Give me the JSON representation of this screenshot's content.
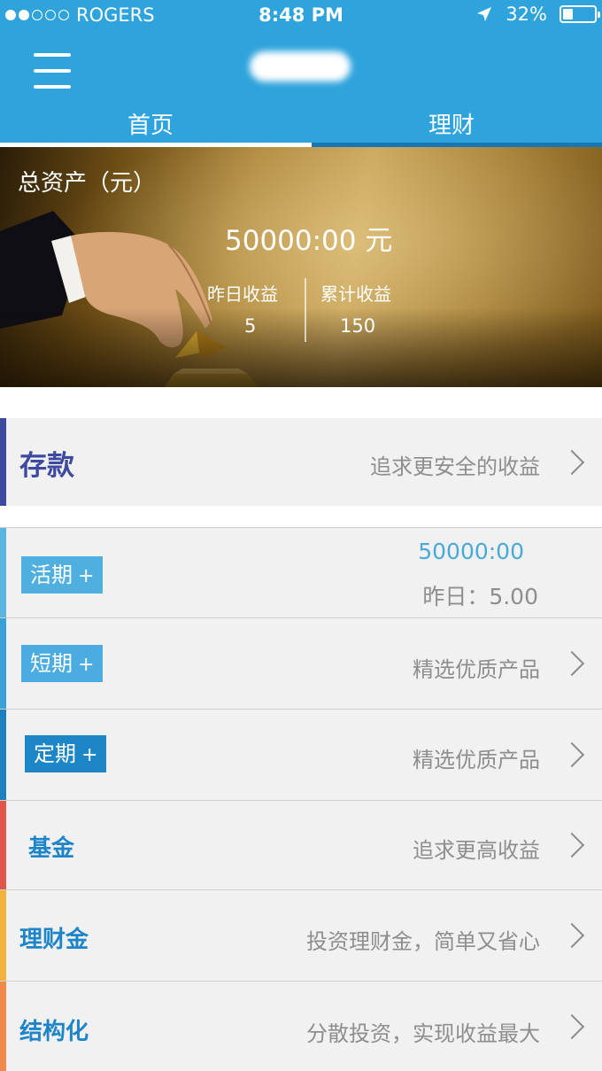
{
  "status_bar": {
    "carrier": "ROGERS",
    "time": "8:48 PM",
    "battery": "32%",
    "battery_level": 0.32
  },
  "header": {
    "tabs": [
      {
        "label": "首页",
        "active": true
      },
      {
        "label": "理财",
        "active": false
      }
    ]
  },
  "banner": {
    "label": "总资产（元）",
    "amount": "50000:00 元",
    "yesterday_label": "昨日收益",
    "yesterday_value": "5",
    "total_label": "累计收益",
    "total_value": "150"
  },
  "list": {
    "deposit": {
      "title": "存款",
      "desc": "追求更安全的收益"
    },
    "current": {
      "label": "活期",
      "plus": "+",
      "amount": "50000:00",
      "yesterday": "昨日：5.00"
    },
    "short_term": {
      "label": "短期",
      "plus": "+",
      "desc": "精选优质产品"
    },
    "fixed_term": {
      "label": "定期",
      "plus": "+",
      "desc": "精选优质产品"
    },
    "fund": {
      "title": "基金",
      "desc": "追求更高收益"
    },
    "wealth_gold": {
      "title": "理财金",
      "desc": "投资理财金，简单又省心"
    },
    "structured": {
      "title": "结构化",
      "desc": "分散投资，实现收益最大"
    }
  },
  "colors": {
    "header_blue": "#2fa3dc",
    "deposit_bar": "#3e4aa0",
    "current_bar": "#5ab5e0",
    "short_bar": "#3aa0da",
    "fixed_bar": "#1e7fbf",
    "fund_bar": "#e0574a",
    "wealth_bar": "#f2b33d",
    "structured_bar": "#ee8a4a"
  },
  "icons": [
    "menu-icon",
    "location-arrow-icon",
    "battery-icon",
    "chevron-right-icon"
  ]
}
